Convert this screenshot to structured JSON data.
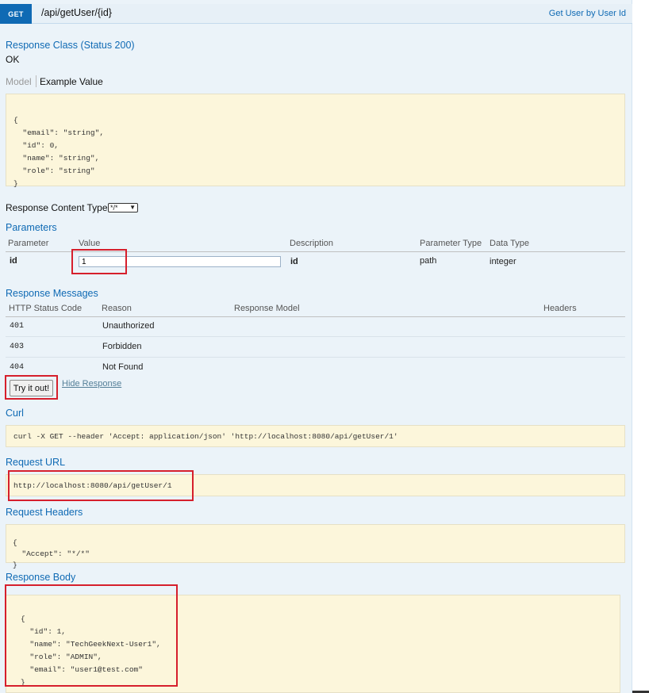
{
  "endpoint": {
    "method": "GET",
    "path": "/api/getUser/{id}",
    "summary": "Get User by User Id"
  },
  "response_class": {
    "heading": "Response Class (Status 200)",
    "status_text": "OK",
    "tabs": [
      {
        "label": "Model",
        "active": false
      },
      {
        "label": "Example Value",
        "active": true
      }
    ],
    "example_lines": [
      "{",
      "  \"email\": \"string\",",
      "  \"id\": 0,",
      "  \"name\": \"string\",",
      "  \"role\": \"string\"",
      "}"
    ]
  },
  "content_type": {
    "label": "Response Content Type",
    "selected": "*/*"
  },
  "parameters": {
    "heading": "Parameters",
    "columns": [
      "Parameter",
      "Value",
      "Description",
      "Parameter Type",
      "Data Type"
    ],
    "rows": [
      {
        "name": "id",
        "value": "1",
        "description": "id",
        "param_type": "path",
        "data_type": "integer"
      }
    ]
  },
  "response_messages": {
    "heading": "Response Messages",
    "columns": [
      "HTTP Status Code",
      "Reason",
      "Response Model",
      "Headers"
    ],
    "rows": [
      {
        "code": "401",
        "reason": "Unauthorized"
      },
      {
        "code": "403",
        "reason": "Forbidden"
      },
      {
        "code": "404",
        "reason": "Not Found"
      }
    ]
  },
  "actions": {
    "try_label": "Try it out!",
    "hide_label": "Hide Response"
  },
  "curl": {
    "heading": "Curl",
    "command": "curl -X GET --header 'Accept: application/json' 'http://localhost:8080/api/getUser/1'"
  },
  "request_url": {
    "heading": "Request URL",
    "url": "http://localhost:8080/api/getUser/1"
  },
  "request_headers": {
    "heading": "Request Headers",
    "lines": [
      "{",
      "  \"Accept\": \"*/*\"",
      "}"
    ]
  },
  "response_body": {
    "heading": "Response Body",
    "lines": [
      "{",
      "  \"id\": 1,",
      "  \"name\": \"TechGeekNext-User1\",",
      "  \"role\": \"ADMIN\",",
      "  \"email\": \"user1@test.com\"",
      "}"
    ]
  },
  "colors": {
    "accent": "#0f6ab4",
    "highlight_box": "#d61f2c",
    "snippet_bg": "#fcf6db",
    "panel_bg": "#ebf3f9"
  }
}
